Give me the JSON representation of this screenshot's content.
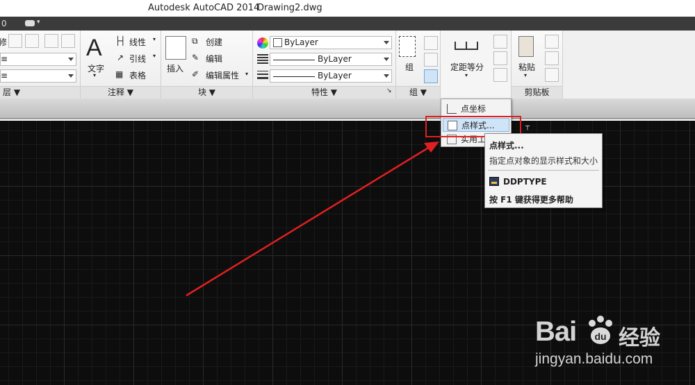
{
  "app": {
    "title": "Autodesk AutoCAD 2014",
    "file": "Drawing2.dwg",
    "tab_number": "0"
  },
  "ribbon": {
    "layers": {
      "title": "层 ▼",
      "edge_text": "修",
      "combo1_text": "≡",
      "combo2_text": "≡"
    },
    "annotation": {
      "title": "注释 ▼",
      "text_label": "文字",
      "linear_label": "线性",
      "leader_label": "引线",
      "table_label": "表格"
    },
    "block": {
      "title": "块 ▼",
      "insert_label": "插入",
      "create_label": "创建",
      "edit_label": "编辑",
      "edit_attr_label": "编辑属性"
    },
    "properties": {
      "title": "特性 ▼",
      "color": "ByLayer",
      "linetype": "ByLayer",
      "lineweight": "ByLayer"
    },
    "groups": {
      "title": "组 ▼",
      "group_label": "组"
    },
    "utilities": {
      "measure_label": "定距等分"
    },
    "clipboard": {
      "title": "剪贴板",
      "paste_label": "粘贴"
    }
  },
  "dropdown": {
    "items": [
      {
        "label": "点坐标"
      },
      {
        "label": "点样式..."
      },
      {
        "label": "实用工具"
      }
    ]
  },
  "tooltip": {
    "title": "点样式...",
    "description": "指定点对象的显示样式和大小",
    "command": "DDPTYPE",
    "help": "按 F1 键获得更多帮助"
  },
  "watermark": {
    "brand": "Bai",
    "cn": "经验",
    "url": "jingyan.baidu.com"
  },
  "colors": {
    "annotation_red": "#e02020",
    "canvas": "#0d0d0d",
    "highlight": "#cfe4f7"
  }
}
